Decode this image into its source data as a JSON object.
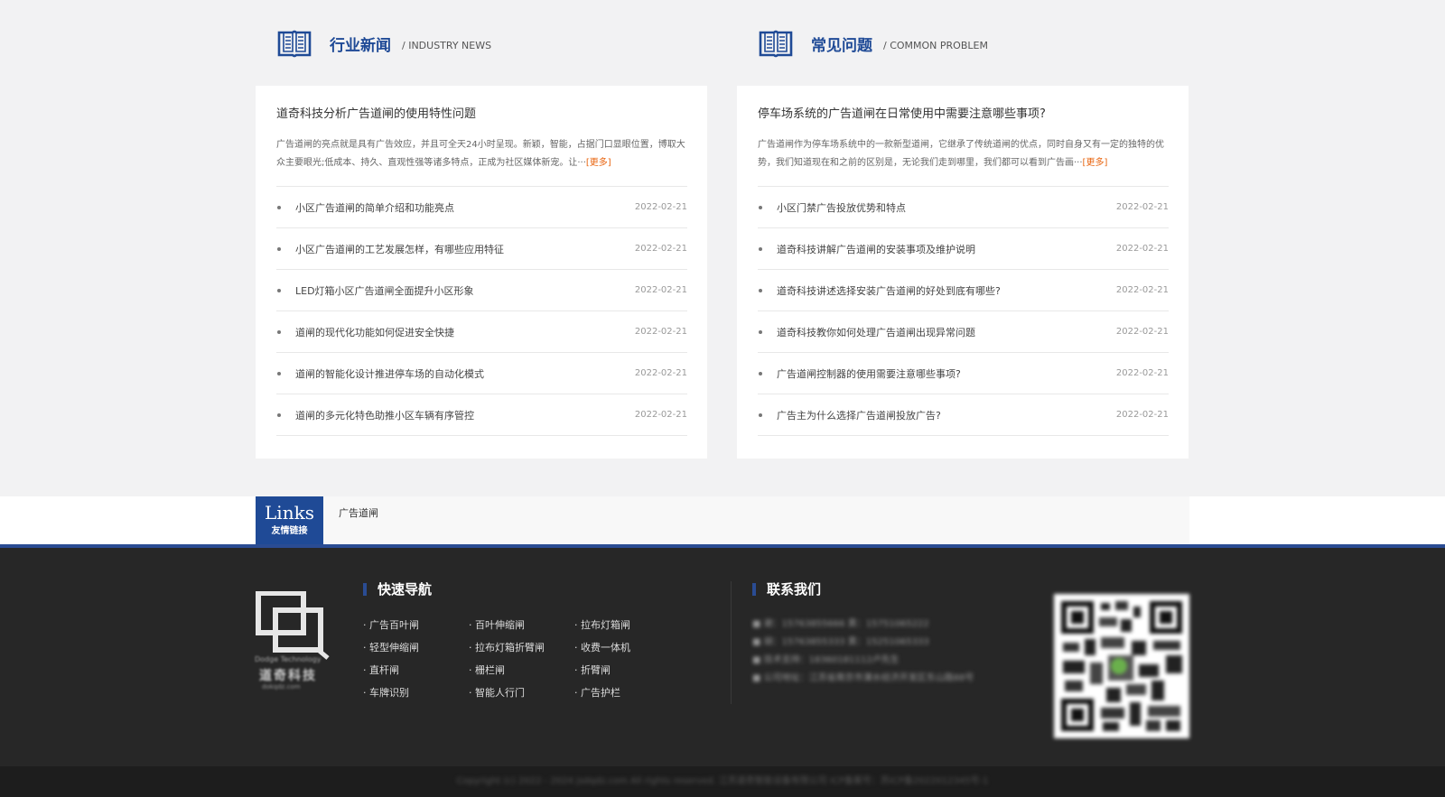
{
  "industry_news": {
    "title": "行业新闻",
    "subtitle": "/ INDUSTRY NEWS",
    "icon": "book-icon",
    "featured_title": "道奇科技分析广告道闸的使用特性问题",
    "featured_desc": "广告道闸的亮点就是具有广告效应，并且可全天24小时呈现。新颖，智能，占据门口显眼位置，博取大众主要眼光;低成本、持久、直观性强等诸多特点，正成为社区媒体新宠。让···",
    "more_label": "[更多]",
    "items": [
      {
        "title": "小区广告道闸的简单介绍和功能亮点",
        "date": "2022-02-21"
      },
      {
        "title": "小区广告道闸的工艺发展怎样，有哪些应用特征",
        "date": "2022-02-21"
      },
      {
        "title": "LED灯箱小区广告道闸全面提升小区形象",
        "date": "2022-02-21"
      },
      {
        "title": "道闸的现代化功能如何促进安全快捷",
        "date": "2022-02-21"
      },
      {
        "title": "道闸的智能化设计推进停车场的自动化模式",
        "date": "2022-02-21"
      },
      {
        "title": "道闸的多元化特色助推小区车辆有序管控",
        "date": "2022-02-21"
      }
    ]
  },
  "common_problem": {
    "title": "常见问题",
    "subtitle": "/ COMMON PROBLEM",
    "icon": "book-icon",
    "featured_title": "停车场系统的广告道闸在日常使用中需要注意哪些事项?",
    "featured_desc": "广告道闸作为停车场系统中的一款新型道闸，它继承了传统道闸的优点，同时自身又有一定的独特的优势，我们知道现在和之前的区别是，无论我们走到哪里，我们都可以看到广告画···",
    "more_label": "[更多]",
    "items": [
      {
        "title": "小区门禁广告投放优势和特点",
        "date": "2022-02-21"
      },
      {
        "title": "道奇科技讲解广告道闸的安装事项及维护说明",
        "date": "2022-02-21"
      },
      {
        "title": "道奇科技讲述选择安装广告道闸的好处到底有哪些?",
        "date": "2022-02-21"
      },
      {
        "title": "道奇科技教你如何处理广告道闸出现异常问题",
        "date": "2022-02-21"
      },
      {
        "title": "广告道闸控制器的使用需要注意哪些事项?",
        "date": "2022-02-21"
      },
      {
        "title": "广告主为什么选择广告道闸投放广告?",
        "date": "2022-02-21"
      }
    ]
  },
  "links": {
    "badge_en": "Links",
    "badge_cn": "友情链接",
    "items": [
      "广告道闸"
    ]
  },
  "footer": {
    "logo": {
      "brand_en": "Dodge Technology",
      "brand_cn": "道奇科技",
      "url": "dokqdz.com"
    },
    "quick_nav": {
      "title": "快速导航",
      "items": [
        "· 广告百叶闸",
        "· 百叶伸缩闸",
        "· 拉布灯箱闸",
        "· 轻型伸缩闸",
        "· 拉布灯箱折臂闸",
        "· 收费一体机",
        "· 直杆闸",
        "· 栅栏闸",
        "· 折臂闸",
        "· 车牌识别",
        "· 智能人行门",
        "· 广告护栏"
      ]
    },
    "contact": {
      "title": "联系我们",
      "lines": [
        "■ 谢：15763855666  黄：15751065222",
        "■ 胡：15763855333  黄：15251065333",
        "■ 技术支持：18360181112卢先生",
        "■ 公司地址：江苏省南京市溧水经济开发区东山路88号"
      ]
    },
    "copyright": "Copyright (c) 2022 - 2024 jsdqdz.com All rights reserved. 江苏道奇智能设备有限公司 ICP备案号：苏ICP备2022012345号-1"
  },
  "colors": {
    "brand_blue": "#1f4a96",
    "more_orange": "#e8640f",
    "footer_bg": "#272727"
  }
}
